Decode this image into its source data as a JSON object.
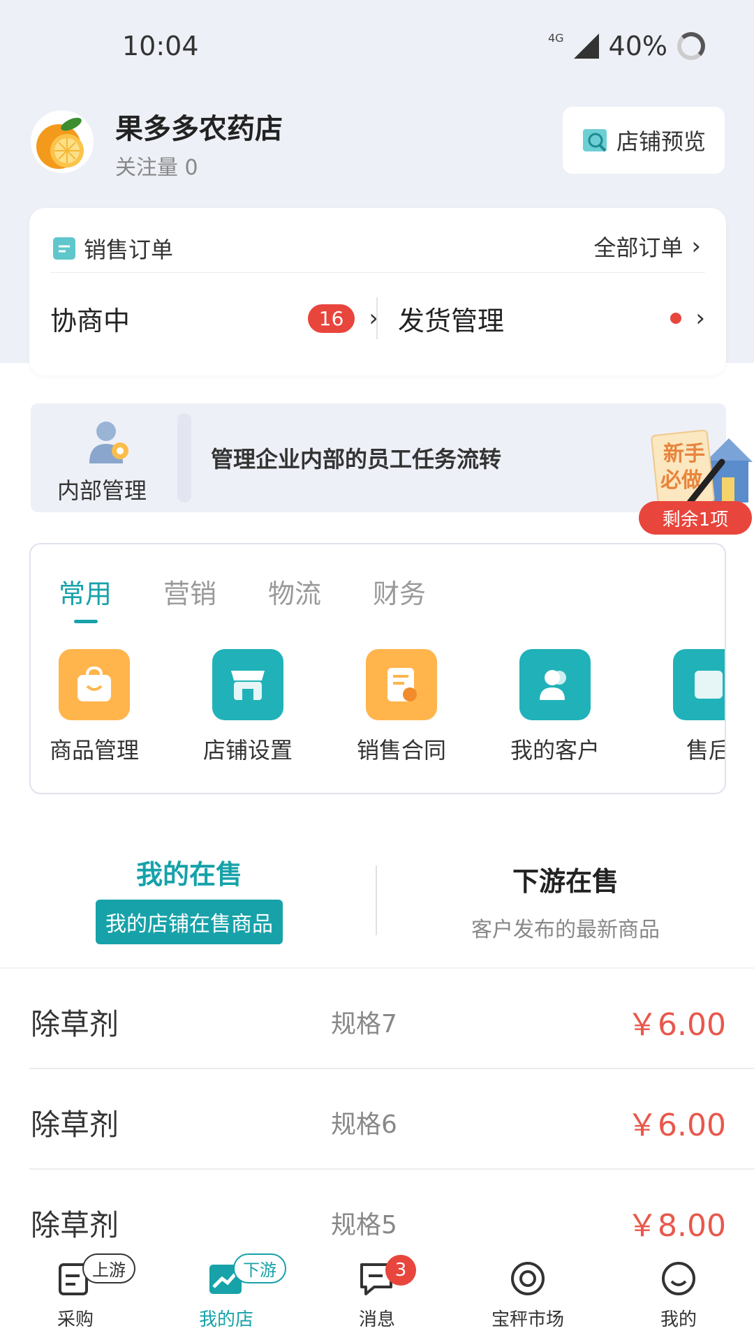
{
  "status_bar": {
    "time": "10:04",
    "network": "4G",
    "battery": "40%"
  },
  "shop": {
    "name": "果多多农药店",
    "follow_label": "关注量 0",
    "preview_label": "店铺预览"
  },
  "orders": {
    "title": "销售订单",
    "all_label": "全部订单",
    "negotiating_label": "协商中",
    "negotiating_count": "16",
    "shipping_label": "发货管理"
  },
  "internal": {
    "label": "内部管理",
    "description": "管理企业内部的员工任务流转",
    "newbie_line1": "新手",
    "newbie_line2": "必做",
    "remaining": "剩余1项"
  },
  "tools": {
    "tabs": [
      "常用",
      "营销",
      "物流",
      "财务"
    ],
    "items": [
      {
        "label": "商品管理",
        "icon": "bag-icon",
        "color": "#ffb54c"
      },
      {
        "label": "店铺设置",
        "icon": "store-icon",
        "color": "#20b2b8"
      },
      {
        "label": "销售合同",
        "icon": "contract-icon",
        "color": "#ffb54c"
      },
      {
        "label": "我的客户",
        "icon": "customers-icon",
        "color": "#20b2b8"
      },
      {
        "label": "售后",
        "icon": "aftersale-icon",
        "color": "#20b2b8"
      }
    ]
  },
  "on_sale": {
    "mine_title": "我的在售",
    "mine_tag": "我的店铺在售商品",
    "downstream_title": "下游在售",
    "downstream_sub": "客户发布的最新商品"
  },
  "products": [
    {
      "name": "除草剂",
      "spec": "规格7",
      "price": "￥6.00"
    },
    {
      "name": "除草剂",
      "spec": "规格6",
      "price": "￥6.00"
    },
    {
      "name": "除草剂",
      "spec": "规格5",
      "price": "￥8.00"
    }
  ],
  "nav": {
    "items": [
      {
        "label": "采购",
        "tag": "上游"
      },
      {
        "label": "我的店",
        "tag": "下游"
      },
      {
        "label": "消息",
        "badge": "3"
      },
      {
        "label": "宝秤市场"
      },
      {
        "label": "我的"
      }
    ]
  },
  "colors": {
    "accent": "#17a2a9",
    "price": "#e8584c",
    "badge": "#e8453c",
    "orange": "#ffb54c"
  }
}
